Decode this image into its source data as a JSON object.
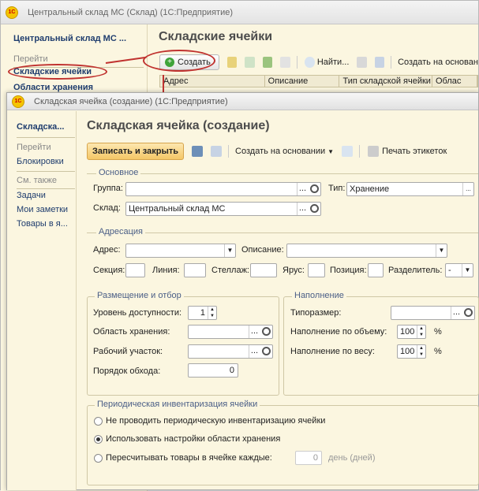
{
  "back_window": {
    "title": "Центральный склад МС (Склад) (1С:Предприятие)",
    "logo": "1С",
    "sidebar": {
      "app_name": "Центральный склад МС ...",
      "go_label": "Перейти",
      "items": [
        "Складские ячейки",
        "Области хранения"
      ]
    },
    "heading": "Складские ячейки",
    "toolbar": {
      "create": "Создать",
      "find": "Найти...",
      "create_based": "Создать на основан"
    },
    "table_columns": [
      "Адрес",
      "Описание",
      "Тип складской ячейки",
      "Облас"
    ]
  },
  "front_window": {
    "title": "Складская ячейка (создание) (1С:Предприятие)",
    "sidebar": {
      "caption": "Складска...",
      "go_label": "Перейти",
      "go_items": [
        "Блокировки"
      ],
      "see_also": "См. также",
      "see_items": [
        "Задачи",
        "Мои заметки",
        "Товары в я..."
      ]
    },
    "heading": "Складская ячейка (создание)",
    "toolbar": {
      "save_close": "Записать и закрыть",
      "create_based": "Создать на основании",
      "print_labels": "Печать этикеток"
    },
    "main_group": {
      "title": "Основное",
      "group_label": "Группа:",
      "group_value": "",
      "type_label": "Тип:",
      "type_value": "Хранение",
      "warehouse_label": "Склад:",
      "warehouse_value": "Центральный склад МС"
    },
    "address_group": {
      "title": "Адресация",
      "address_label": "Адрес:",
      "address_value": "",
      "description_label": "Описание:",
      "description_value": "",
      "section_label": "Секция:",
      "line_label": "Линия:",
      "rack_label": "Стеллаж:",
      "tier_label": "Ярус:",
      "position_label": "Позиция:",
      "separator_label": "Разделитель:",
      "separator_value": "-"
    },
    "placement_group": {
      "title": "Размещение и отбор",
      "access_label": "Уровень доступности:",
      "access_value": "1",
      "storage_area_label": "Область хранения:",
      "work_area_label": "Рабочий участок:",
      "order_label": "Порядок обхода:",
      "order_value": "0"
    },
    "filling_group": {
      "title": "Наполнение",
      "size_label": "Типоразмер:",
      "volume_label": "Наполнение по объему:",
      "volume_value": "100",
      "weight_label": "Наполнение по весу:",
      "weight_value": "100",
      "percent": "%"
    },
    "inventory_group": {
      "title": "Периодическая инвентаризация ячейки",
      "opt1": "Не проводить периодическую инвентаризацию ячейки",
      "opt2": "Использовать настройки области хранения",
      "opt3": "Пересчитывать товары в ячейке каждые:",
      "days_value": "0",
      "days_unit": "день (дней)",
      "selected": 2
    }
  },
  "colors": {
    "highlight": "#c0322f",
    "accent_button": "#f4c766",
    "link": "#1f3d6e"
  }
}
